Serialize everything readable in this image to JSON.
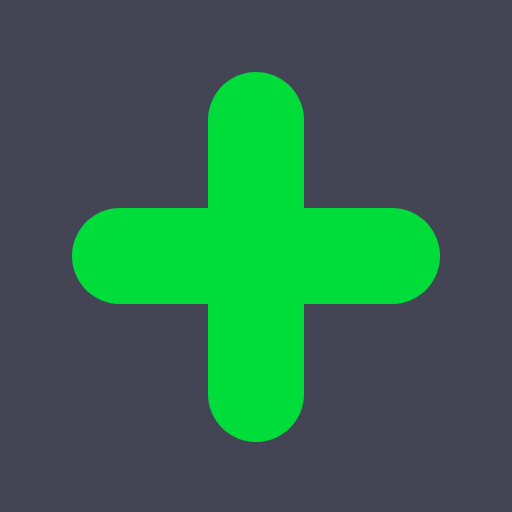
{
  "icon": {
    "name": "plus-icon",
    "background_color": "#434554",
    "glyph_color": "#00DC3A"
  }
}
